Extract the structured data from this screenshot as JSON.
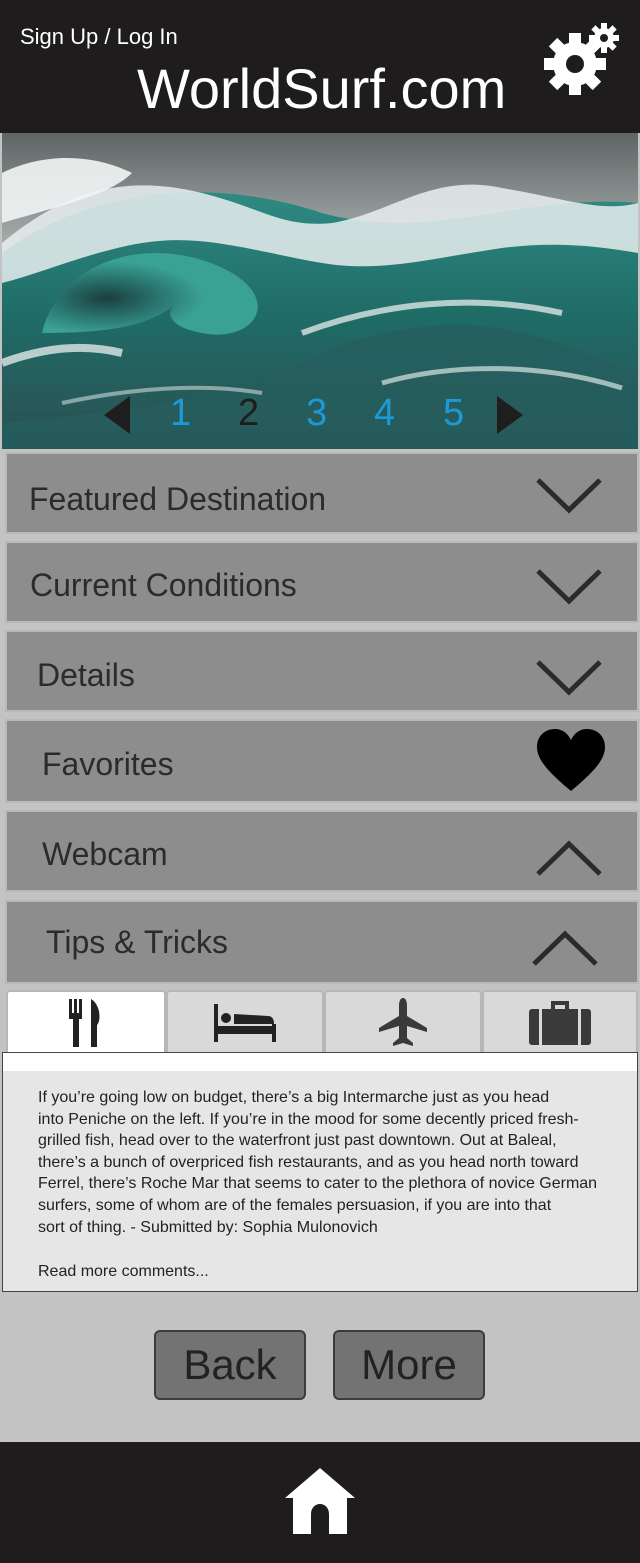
{
  "header": {
    "signup_label": "Sign Up / Log In",
    "site_title": "WorldSurf.com",
    "settings_icon": "gear-icon"
  },
  "hero": {
    "image": "ocean-wave-photo",
    "pages": [
      "1",
      "2",
      "3",
      "4",
      "5"
    ],
    "current_page": "2",
    "page_color_active": "#1e1e1e",
    "page_color": "#1b9ad7"
  },
  "accordion": [
    {
      "label": "Featured Destination",
      "icon": "chevron-down-icon"
    },
    {
      "label": "Current Conditions",
      "icon": "chevron-down-icon"
    },
    {
      "label": "Details",
      "icon": "chevron-down-icon"
    },
    {
      "label": "Favorites",
      "icon": "heart-icon"
    },
    {
      "label": "Webcam",
      "icon": "chevron-up-icon"
    },
    {
      "label": "Tips & Tricks",
      "icon": "chevron-up-icon"
    }
  ],
  "tabs": [
    {
      "icon": "restaurant-icon",
      "active": true
    },
    {
      "icon": "bed-icon",
      "active": false
    },
    {
      "icon": "airplane-icon",
      "active": false
    },
    {
      "icon": "luggage-icon",
      "active": false
    }
  ],
  "comment": {
    "lines": [
      "If you’re going low on budget, there’s a big Intermarche just as you head",
      "into Peniche on the left.  If you’re in the mood for some decently priced fresh-",
      "grilled fish, head over to the waterfront just past downtown.  Out at Baleal,",
      "there’s a bunch of overpriced fish restaurants, and as you head north toward",
      "Ferrel, there’s Roche Mar that seems to cater to the plethora of novice German",
      "surfers, some of whom are of the females persuasion, if you are into that",
      "sort of thing.  -  Submitted by:  Sophia Mulonovich"
    ],
    "read_more": "Read more comments..."
  },
  "buttons": {
    "back": "Back",
    "more": "More"
  },
  "footer": {
    "home_icon": "home-icon"
  }
}
